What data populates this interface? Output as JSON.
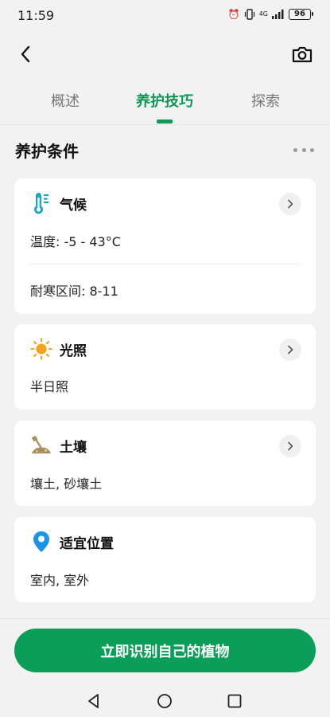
{
  "status_bar": {
    "time": "11:59",
    "network": "4G",
    "battery": "96"
  },
  "tabs": [
    {
      "label": "概述",
      "active": false
    },
    {
      "label": "养护技巧",
      "active": true
    },
    {
      "label": "探索",
      "active": false
    }
  ],
  "section": {
    "title": "养护条件"
  },
  "cards": {
    "climate": {
      "title": "气候",
      "temperature": "温度: -5 - 43°C",
      "hardiness": "耐寒区间: 8-11"
    },
    "light": {
      "title": "光照",
      "value": "半日照"
    },
    "soil": {
      "title": "土壤",
      "value": "壤土, 砂壤土"
    },
    "location": {
      "title": "适宜位置",
      "value": "室内, 室外"
    }
  },
  "cta": {
    "label": "立即识别自己的植物"
  },
  "colors": {
    "accent": "#0a9a55",
    "background": "#f2f2f2",
    "card": "#ffffff"
  }
}
